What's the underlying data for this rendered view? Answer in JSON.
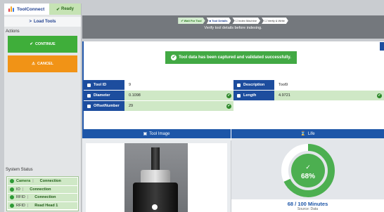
{
  "app": {
    "title": "ToolConnect",
    "status": "Ready"
  },
  "sidebar": {
    "load_label": "Load Tools",
    "actions_title": "Actions",
    "continue_label": "CONTINUE",
    "cancel_label": "CANCEL",
    "status_title": "System Status",
    "status": [
      {
        "tag": "Camera",
        "sep": "|",
        "value": "Connection"
      },
      {
        "tag": "IO",
        "sep": "|",
        "value": "Connection"
      },
      {
        "tag": "RFID",
        "sep": "|",
        "value": "Connection"
      },
      {
        "tag": "RFID",
        "sep": "|",
        "value": "Read Head 1"
      }
    ]
  },
  "steps": [
    {
      "label": "Wait For Tool",
      "state": "done"
    },
    {
      "label": "Tool Details",
      "state": "active"
    },
    {
      "label": "Index Machine",
      "state": "todo"
    },
    {
      "label": "Verify & Write",
      "state": "todo"
    }
  ],
  "subtitle": "Verify tool details before indexing.",
  "alert": "Tool data has been captured and validated successfully.",
  "fields": {
    "tool_id_label": "Tool ID",
    "tool_id_value": "9",
    "description_label": "Description",
    "description_value": "Tool9",
    "diameter_label": "Diameter",
    "diameter_value": "0.1098",
    "length_label": "Length",
    "length_value": "4.9721",
    "offset_label": "OffsetNumber",
    "offset_value": "29"
  },
  "image_panel": {
    "title": "Tool Image"
  },
  "life": {
    "title": "Life",
    "percent": 68,
    "percent_label": "68%",
    "summary": "68 / 100 Minutes",
    "source": "Source: Data",
    "gauge_color": "#4caf50"
  },
  "colors": {
    "accent": "#1d56a8",
    "success": "#42a944",
    "warning": "#f19316"
  }
}
